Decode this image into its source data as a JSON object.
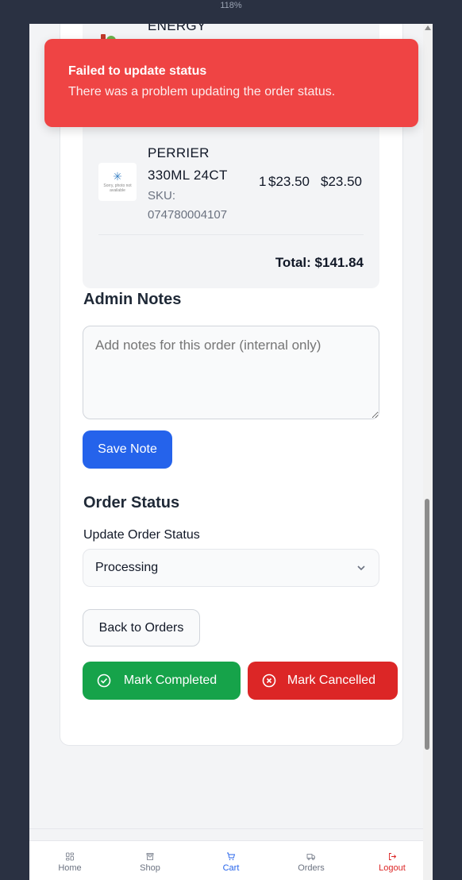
{
  "browser": {
    "zoom": "118%"
  },
  "items": {
    "previous_item_name": "ENERGY",
    "item": {
      "name": "PERRIER 330ML 24CT",
      "sku": "SKU: 074780004107",
      "qty": "1",
      "price": "$23.50",
      "total": "$23.50",
      "image_alt": "Sorry, photo not available"
    },
    "order_total": "Total: $141.84"
  },
  "notes": {
    "title": "Admin Notes",
    "placeholder": "Add notes for this order (internal only)",
    "save_label": "Save Note"
  },
  "status": {
    "title": "Order Status",
    "select_label": "Update Order Status",
    "selected": "Processing",
    "back_label": "Back to Orders",
    "complete_label": "Mark Completed",
    "cancel_label": "Mark Cancelled"
  },
  "toast": {
    "title": "Failed to update status",
    "description": "There was a problem updating the order status."
  },
  "bottom_nav": {
    "items": [
      {
        "label": "Home",
        "icon": "grid-icon",
        "active": false
      },
      {
        "label": "Shop",
        "icon": "shop-icon",
        "active": false
      },
      {
        "label": "Cart",
        "icon": "cart-icon",
        "active": true
      },
      {
        "label": "Orders",
        "icon": "truck-icon",
        "active": false
      },
      {
        "label": "Logout",
        "icon": "logout-icon",
        "active": false
      }
    ]
  },
  "colors": {
    "primary": "#2563eb",
    "success": "#16a34a",
    "danger": "#dc2626",
    "toast": "#ef4444"
  }
}
